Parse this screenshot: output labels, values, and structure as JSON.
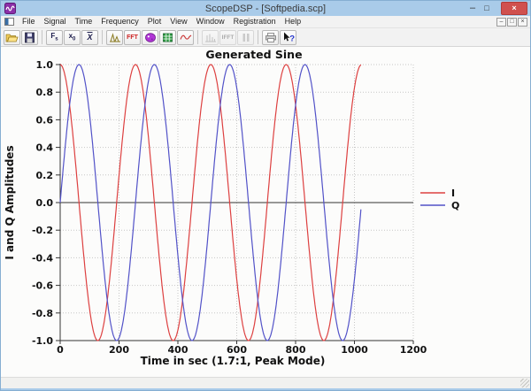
{
  "window": {
    "title": "ScopeDSP - [Softpedia.scp]",
    "controls": {
      "minimize": "–",
      "maximize": "□",
      "close": "×"
    },
    "mdi_controls": {
      "minimize": "–",
      "restore": "□",
      "close": "×"
    }
  },
  "menu": {
    "items": [
      "File",
      "Signal",
      "Time",
      "Frequency",
      "Plot",
      "View",
      "Window",
      "Registration",
      "Help"
    ]
  },
  "toolbar": {
    "fs": {
      "main": "F",
      "sub": "s"
    },
    "x0": {
      "main": "x",
      "sub": "0"
    },
    "xbar": "X",
    "fft_label": "FFT",
    "ifft_label": "IFFT",
    "pause_label": "||"
  },
  "chart_data": {
    "type": "line",
    "title": "Generated Sine",
    "xlabel": "Time in sec (1.7:1, Peak Mode)",
    "ylabel": "I and Q Amplitudes",
    "xlim": [
      0,
      1200
    ],
    "ylim": [
      -1.0,
      1.0
    ],
    "xticks": [
      0,
      200,
      400,
      600,
      800,
      1000,
      1200
    ],
    "yticks": [
      1.0,
      0.8,
      0.6,
      0.4,
      0.2,
      0.0,
      -0.2,
      -0.4,
      -0.6,
      -0.8,
      -1.0
    ],
    "grid": true,
    "legend_position": "right",
    "legend": [
      "I",
      "Q"
    ],
    "series": [
      {
        "name": "I",
        "color": "#dd4040",
        "waveform": "cosine",
        "amplitude": 1.0,
        "period": 256,
        "t_start": 0,
        "t_end": 1023
      },
      {
        "name": "Q",
        "color": "#5252c8",
        "waveform": "sine",
        "amplitude": 1.0,
        "period": 256,
        "t_start": 0,
        "t_end": 1023
      }
    ],
    "axis_color": "#333333",
    "grid_color": "#c6c6c6"
  }
}
